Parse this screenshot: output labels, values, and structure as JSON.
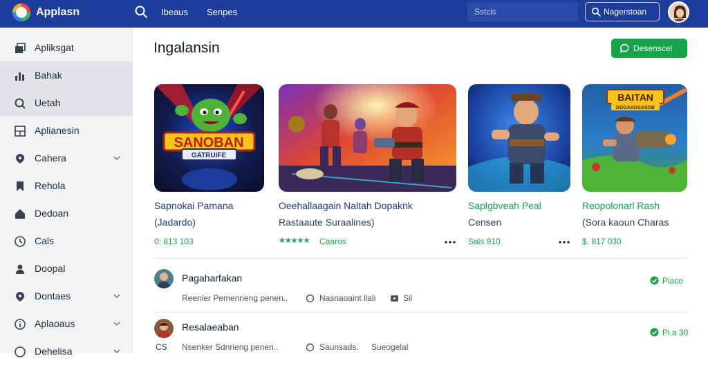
{
  "header": {
    "app_title": "Applasn",
    "nav_links": [
      "Ibeaus",
      "Senpes"
    ],
    "search_placeholder": "Sstcis",
    "register_label": "Nagerstoan",
    "brand_colors": {
      "bar": "#1e3c9a",
      "accent": "#16a34a"
    }
  },
  "sidebar": {
    "items": [
      {
        "label": "Apliksgat",
        "icon": "layers-icon",
        "has_chevron": false
      },
      {
        "label": "Bahak",
        "icon": "bar-chart-icon",
        "has_chevron": false
      },
      {
        "label": "Uetah",
        "icon": "search-icon",
        "has_chevron": false
      },
      {
        "label": "Aplianesin",
        "icon": "grid-icon",
        "has_chevron": false
      },
      {
        "label": "Cahera",
        "icon": "pin-icon",
        "has_chevron": true
      },
      {
        "label": "Rehola",
        "icon": "bookmark-icon",
        "has_chevron": false
      },
      {
        "label": "Dedoan",
        "icon": "home-icon",
        "has_chevron": false
      },
      {
        "label": "Cals",
        "icon": "clock-icon",
        "has_chevron": false
      },
      {
        "label": "Doopal",
        "icon": "person-icon",
        "has_chevron": false
      },
      {
        "label": "Dontaes",
        "icon": "location-icon",
        "has_chevron": true
      },
      {
        "label": "Aplaoaus",
        "icon": "info-icon",
        "has_chevron": true
      },
      {
        "label": "Dehelisa",
        "icon": "help-icon",
        "has_chevron": true
      }
    ]
  },
  "main": {
    "page_title": "Ingalansin",
    "discover_label": "Desenscel",
    "cards": [
      {
        "title": "Sapnokai Pamana",
        "subtitle": "(Jadardo)",
        "meta": "0: 813 103",
        "banner": "SANOBAN",
        "banner_sub": "GATRUIFE"
      },
      {
        "title": "Oeehallaagain Naltah Dopaknk",
        "subtitle": "Rastaaute Suraalines)",
        "rating_text": "Caaros",
        "stars": "★★★★★"
      },
      {
        "title": "Saplgbveah Peal",
        "subtitle": "Censen",
        "meta": "Sals 910"
      },
      {
        "title": "Reopolonarl Rash",
        "subtitle": "(Sora kaoun Charas",
        "meta": "$. 817 030",
        "banner": "BAITAN",
        "banner_sub": "DOGAADSASOB"
      }
    ],
    "rows": [
      {
        "title": "Pagaharfakan",
        "desc": "Reenler Pemenrieng penen..",
        "meta1": "Nasnaoaint llali",
        "meta2": "Sil",
        "status": "Piaco"
      },
      {
        "title": "Resalaeaban",
        "desc": "Nsenker Sdnrieng penen..",
        "meta1": "Saunsads.",
        "meta2": "Sueogelal",
        "tag": "CS",
        "status": "Pi.a 30"
      }
    ]
  }
}
